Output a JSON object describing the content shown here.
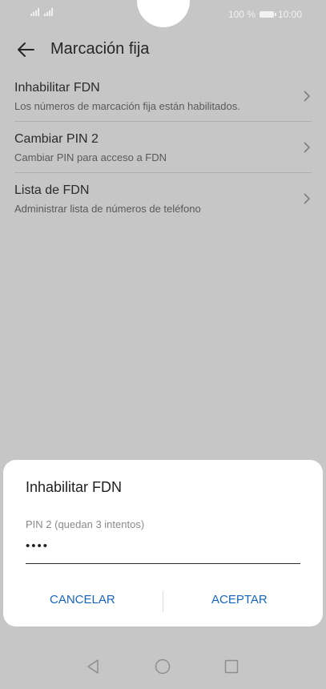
{
  "status_bar": {
    "battery_text": "100 %",
    "time": "10:00"
  },
  "header": {
    "title": "Marcación fija"
  },
  "settings": [
    {
      "title": "Inhabilitar FDN",
      "subtitle": "Los números de marcación fija están habilitados."
    },
    {
      "title": "Cambiar PIN 2",
      "subtitle": "Cambiar PIN para acceso a FDN"
    },
    {
      "title": "Lista de FDN",
      "subtitle": "Administrar lista de números de teléfono"
    }
  ],
  "dialog": {
    "title": "Inhabilitar FDN",
    "field_label": "PIN 2 (quedan 3 intentos)",
    "pin_value": "••••",
    "cancel_label": "CANCELAR",
    "accept_label": "ACEPTAR"
  },
  "colors": {
    "accent": "#1565c0",
    "scrim": "#c6c6c6"
  },
  "icons": [
    "back-arrow-icon",
    "chevron-right-icon",
    "nav-back-icon",
    "nav-home-icon",
    "nav-recents-icon"
  ]
}
